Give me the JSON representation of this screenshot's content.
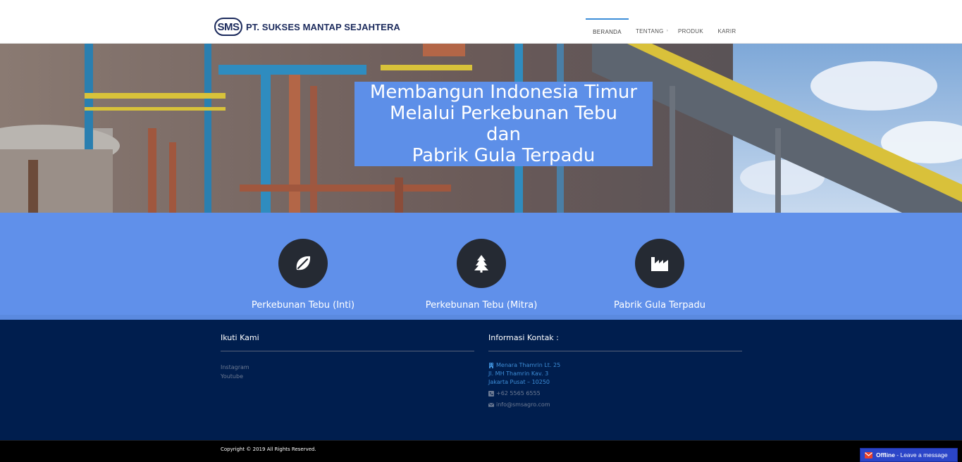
{
  "header": {
    "logo_badge": "SMS",
    "company_name": "PT. SUKSES MANTAP SEJAHTERA",
    "nav": [
      {
        "label": "BERANDA",
        "active": true
      },
      {
        "label": "TENTANG",
        "caret": "›"
      },
      {
        "label": "PRODUK"
      },
      {
        "label": "KARIR"
      }
    ]
  },
  "hero": {
    "title_lines": [
      "Membangun Indonesia Timur",
      "Melalui Perkebunan Tebu",
      "dan",
      "Pabrik Gula Terpadu"
    ]
  },
  "features": [
    {
      "icon": "leaf-icon",
      "label": "Perkebunan Tebu (Inti)"
    },
    {
      "icon": "tree-icon",
      "label": "Perkebunan Tebu (Mitra)"
    },
    {
      "icon": "factory-icon",
      "label": "Pabrik Gula Terpadu"
    }
  ],
  "footer": {
    "follow": {
      "heading": "Ikuti Kami",
      "links": [
        "Instagram",
        "Youtube"
      ]
    },
    "contact": {
      "heading": "Informasi Kontak :",
      "address": [
        "Menara Thamrin Lt. 25",
        "Jl. MH Thamrin Kav. 3",
        "Jakarta Pusat – 10250"
      ],
      "phone": "+62 5565 6555",
      "email": "info@smsagro.com"
    }
  },
  "bottom": {
    "copyright": "Copyright © 2019 All Rights Reserved."
  },
  "chat": {
    "status": "Offline",
    "message": " - Leave a message"
  },
  "colors": {
    "brand_navy": "#1b2a5c",
    "feature_blue": "#6090ea",
    "footer_navy": "#001e4e",
    "link_blue": "#3d8ed8"
  }
}
